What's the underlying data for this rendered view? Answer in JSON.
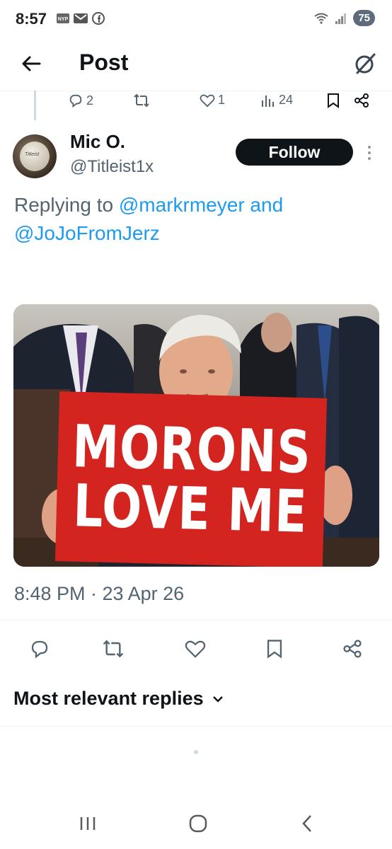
{
  "status_bar": {
    "time": "8:57",
    "left_icons": [
      "nyp-icon",
      "mail-icon",
      "facebook-icon"
    ],
    "battery": "75"
  },
  "header": {
    "title": "Post"
  },
  "previous_tweet_actions": {
    "replies": "2",
    "likes": "1",
    "views": "24"
  },
  "tweet": {
    "author_name": "Mic O.",
    "author_handle": "@Titleist1x",
    "follow_label": "Follow",
    "replying_prefix": "Replying to",
    "replying_mention_1": "@markrmeyer",
    "replying_and": "and",
    "replying_mention_2": "@JoJoFromJerz",
    "image_sign_line_1": "MORONS",
    "image_sign_line_2": "LOVE ME",
    "timestamp": "8:48 PM · 23 Apr 26"
  },
  "replies": {
    "sort_label": "Most relevant replies"
  },
  "colors": {
    "accent": "#1d9bf0",
    "muted": "#536471",
    "text": "#0f1419",
    "sign_red": "#d4241f"
  }
}
